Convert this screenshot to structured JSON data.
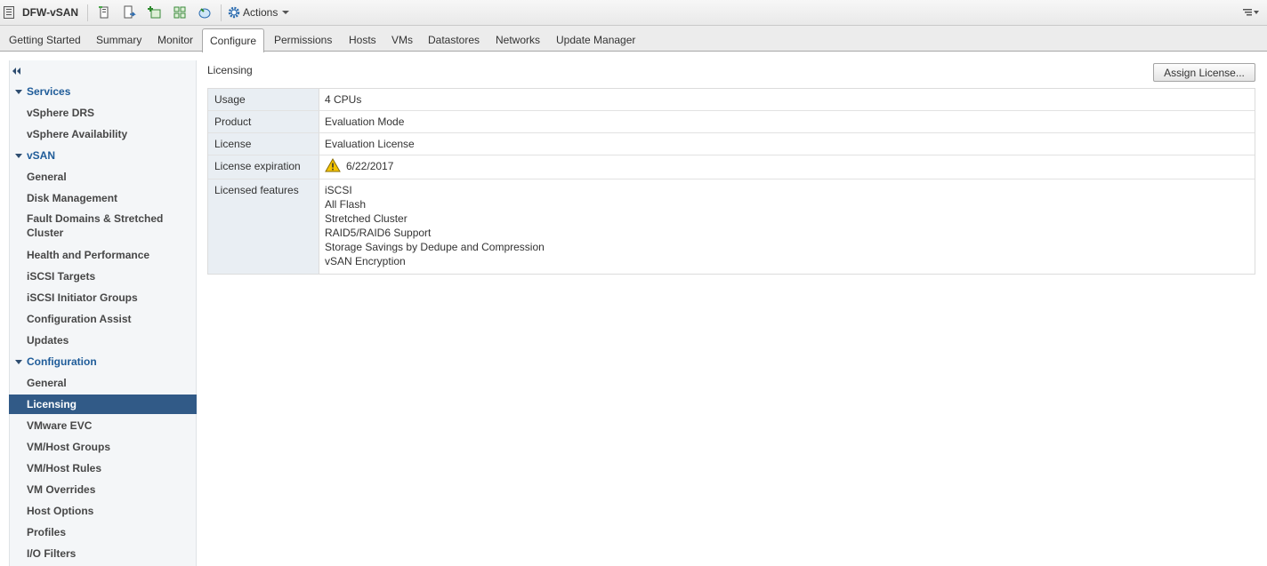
{
  "toolbar": {
    "title": "DFW-vSAN",
    "actions_label": "Actions"
  },
  "tabs": [
    "Getting Started",
    "Summary",
    "Monitor",
    "Configure",
    "Permissions",
    "Hosts",
    "VMs",
    "Datastores",
    "Networks",
    "Update Manager"
  ],
  "active_tab": "Configure",
  "nav": {
    "services": {
      "label": "Services",
      "items": [
        "vSphere DRS",
        "vSphere Availability"
      ]
    },
    "vsan": {
      "label": "vSAN",
      "items": [
        "General",
        "Disk Management",
        "Fault Domains & Stretched Cluster",
        "Health and Performance",
        "iSCSI Targets",
        "iSCSI Initiator Groups",
        "Configuration Assist",
        "Updates"
      ]
    },
    "configuration": {
      "label": "Configuration",
      "items": [
        "General",
        "Licensing",
        "VMware EVC",
        "VM/Host Groups",
        "VM/Host Rules",
        "VM Overrides",
        "Host Options",
        "Profiles",
        "I/O Filters"
      ]
    },
    "selected": "Licensing"
  },
  "main": {
    "title": "Licensing",
    "assign_button": "Assign License...",
    "properties": {
      "usage_label": "Usage",
      "usage_value": "4 CPUs",
      "product_label": "Product",
      "product_value": "Evaluation Mode",
      "license_label": "License",
      "license_value": "Evaluation License",
      "expiration_label": "License expiration",
      "expiration_value": "6/22/2017",
      "features_label": "Licensed features",
      "features": [
        "iSCSI",
        "All Flash",
        "Stretched Cluster",
        "RAID5/RAID6 Support",
        "Storage Savings by Dedupe and Compression",
        "vSAN Encryption"
      ]
    }
  },
  "icons": {
    "object": "cluster-icon",
    "warning": "warning-icon",
    "actions": "gear-icon"
  },
  "colors": {
    "selected_bg": "#315a87",
    "group_text": "#1f5c99",
    "key_bg": "#e9eef3",
    "warning": "#f5c400"
  }
}
